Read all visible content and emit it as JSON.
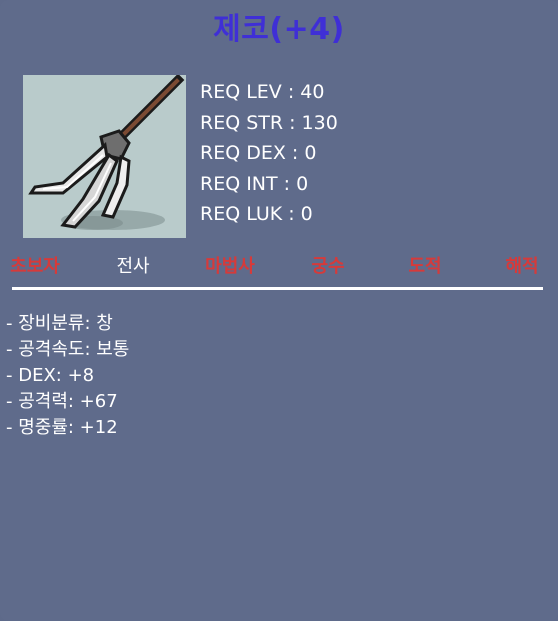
{
  "item": {
    "title": "제코(+4)",
    "icon": "trident-spear-icon"
  },
  "requirements": [
    "REQ LEV : 40",
    "REQ STR : 130",
    "REQ DEX : 0",
    "REQ INT : 0",
    "REQ LUK : 0"
  ],
  "jobs": [
    {
      "label": "초보자",
      "allowed": false
    },
    {
      "label": "전사",
      "allowed": true
    },
    {
      "label": "마법사",
      "allowed": false
    },
    {
      "label": "궁수",
      "allowed": false
    },
    {
      "label": "도적",
      "allowed": false
    },
    {
      "label": "해적",
      "allowed": false
    }
  ],
  "stats": [
    "- 장비분류: 창",
    "- 공격속도: 보통",
    "- DEX: +8",
    "- 공격력: +67",
    "- 명중률: +12"
  ],
  "colors": {
    "background": "#5f6b8b",
    "title": "#3f2fd6",
    "job_disallowed": "#d63a3a",
    "job_allowed": "#ffffff",
    "icon_background": "#b9cbcb"
  }
}
